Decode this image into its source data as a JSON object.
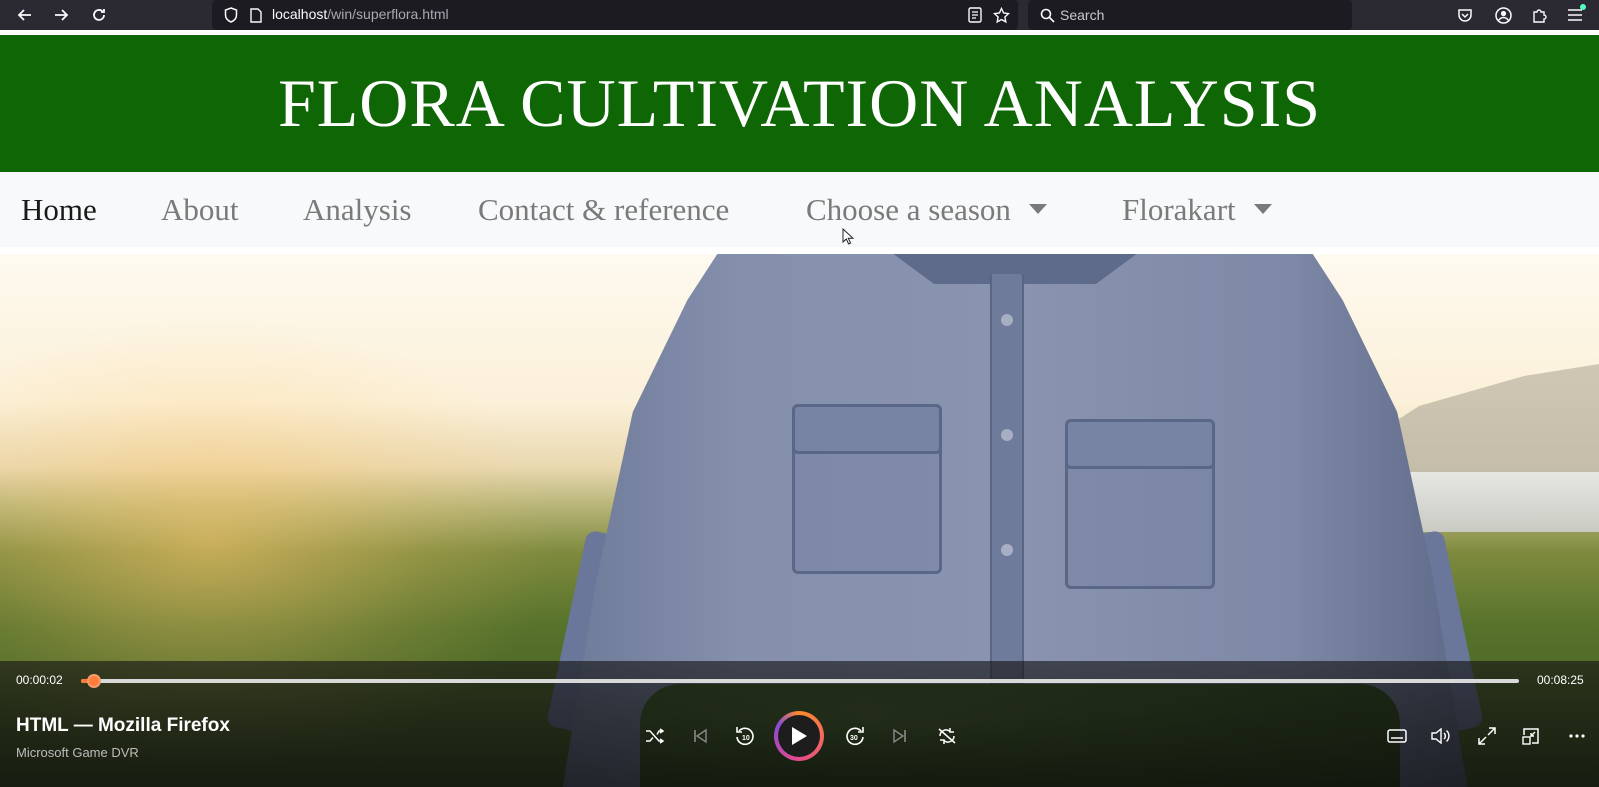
{
  "browser": {
    "url_host": "localhost",
    "url_path": "/win/superflora.html",
    "search_placeholder": "Search"
  },
  "page": {
    "header_title": "FLORA CULTIVATION ANALYSIS",
    "nav": {
      "home": "Home",
      "about": "About",
      "analysis": "Analysis",
      "contact": "Contact & reference",
      "season": "Choose a season",
      "florakart": "Florakart"
    },
    "colors": {
      "header_bg": "#0e6605",
      "navbar_bg": "#f8f9fa"
    }
  },
  "player": {
    "current_time": "00:00:02",
    "total_time": "00:08:25",
    "progress_fraction": 0.004,
    "title": "HTML — Mozilla Firefox",
    "app": "Microsoft Game DVR",
    "accent_color": "#ff7d3b"
  }
}
